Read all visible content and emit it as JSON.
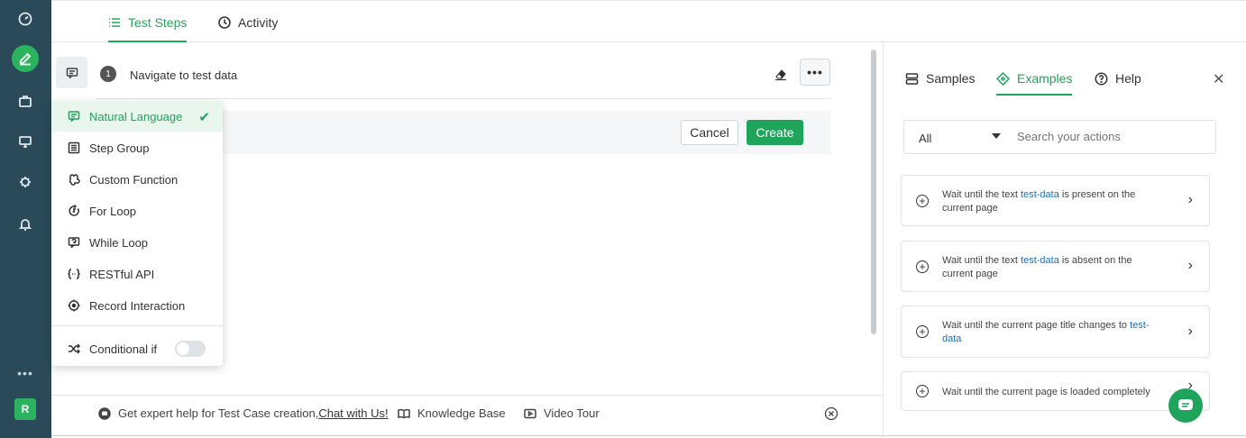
{
  "rail": {
    "items": [
      "dashboard-icon",
      "edit-icon",
      "briefcase-icon",
      "monitor-icon",
      "bug-icon",
      "bell-icon"
    ],
    "more": "•••",
    "avatar": "R"
  },
  "tabs": [
    {
      "label": "Test Steps",
      "active": true
    },
    {
      "label": "Activity",
      "active": false
    }
  ],
  "step": {
    "number": "1",
    "text": "Navigate to test data",
    "more_label": "•••"
  },
  "actions": {
    "cancel": "Cancel",
    "create": "Create"
  },
  "step_types": {
    "items": [
      {
        "label": "Natural Language",
        "icon": "natural-language-icon",
        "selected": true
      },
      {
        "label": "Step Group",
        "icon": "step-group-icon",
        "selected": false
      },
      {
        "label": "Custom Function",
        "icon": "custom-function-icon",
        "selected": false
      },
      {
        "label": "For Loop",
        "icon": "for-loop-icon",
        "selected": false
      },
      {
        "label": "While Loop",
        "icon": "while-loop-icon",
        "selected": false
      },
      {
        "label": "RESTful API",
        "icon": "restful-api-icon",
        "selected": false
      },
      {
        "label": "Record Interaction",
        "icon": "record-interaction-icon",
        "selected": false
      }
    ],
    "check": "✔",
    "conditional": {
      "label": "Conditional if",
      "enabled": false
    }
  },
  "help_bar": {
    "expert_text": "Get expert help for Test Case creation, ",
    "chat_link": "Chat with Us!",
    "knowledge_base": "Knowledge Base",
    "video_tour": "Video Tour"
  },
  "right_panel": {
    "tabs": [
      {
        "label": "Samples",
        "active": false
      },
      {
        "label": "Examples",
        "active": true
      },
      {
        "label": "Help",
        "active": false
      }
    ],
    "close": "✕",
    "filter": "All",
    "search_placeholder": "Search your actions",
    "examples": [
      {
        "before": "Wait until the text ",
        "highlight": "test-data",
        "after": " is present on the current page"
      },
      {
        "before": "Wait until the text ",
        "highlight": "test-data",
        "after": " is absent on the current page"
      },
      {
        "before": "Wait until the current page title changes to ",
        "highlight": "test-data",
        "after": ""
      },
      {
        "before": "Wait until the current page is loaded completely",
        "highlight": "",
        "after": ""
      }
    ]
  },
  "colors": {
    "accent": "#1fa45c",
    "rail": "#2a4a5a",
    "link": "#1f6fb5"
  }
}
